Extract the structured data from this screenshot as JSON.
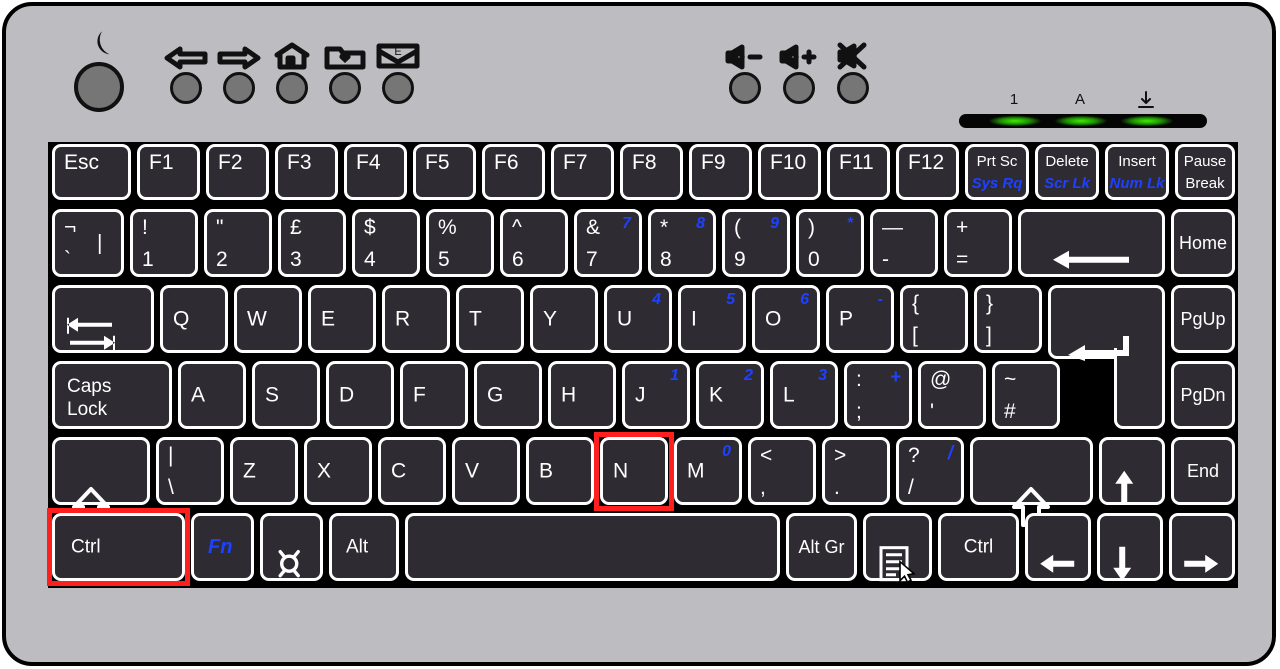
{
  "device": {
    "name": "laptop-style-uk-keyboard",
    "body_color": "#bdbdc1",
    "key_color": "#2e2b33",
    "key_border_color": "#ffffff",
    "legend_color": "#ffffff",
    "fn_legend_color": "#1e41ff",
    "highlight_color": "#ff1f1f",
    "led_color": "#3cf000"
  },
  "hotkeys": [
    {
      "name": "sleep-button",
      "glyph": "moon"
    },
    {
      "name": "back-button",
      "glyph": "arrow-left"
    },
    {
      "name": "forward-button",
      "glyph": "arrow-right"
    },
    {
      "name": "home-button",
      "glyph": "house"
    },
    {
      "name": "favorites-button",
      "glyph": "folder-heart"
    },
    {
      "name": "email-button",
      "glyph": "envelope-e"
    },
    {
      "name": "volume-down-button",
      "glyph": "speaker-minus"
    },
    {
      "name": "volume-up-button",
      "glyph": "speaker-plus"
    },
    {
      "name": "mute-button",
      "glyph": "speaker-mute"
    }
  ],
  "leds": [
    {
      "name": "num-lock-led",
      "label": "1"
    },
    {
      "name": "caps-lock-led",
      "label": "A"
    },
    {
      "name": "scroll-lock-led",
      "label": "scroll-lock-glyph"
    }
  ],
  "highlighted_keys": [
    "N",
    "Ctrl"
  ],
  "rows": {
    "function_row": [
      {
        "name": "esc",
        "main": "Esc"
      },
      {
        "name": "f1",
        "main": "F1"
      },
      {
        "name": "f2",
        "main": "F2"
      },
      {
        "name": "f3",
        "main": "F3"
      },
      {
        "name": "f4",
        "main": "F4"
      },
      {
        "name": "f5",
        "main": "F5"
      },
      {
        "name": "f6",
        "main": "F6"
      },
      {
        "name": "f7",
        "main": "F7"
      },
      {
        "name": "f8",
        "main": "F8"
      },
      {
        "name": "f9",
        "main": "F9"
      },
      {
        "name": "f10",
        "main": "F10"
      },
      {
        "name": "f11",
        "main": "F11"
      },
      {
        "name": "f12",
        "main": "F12"
      },
      {
        "name": "print-screen",
        "main": "Prt Sc",
        "alt": "Sys Rq"
      },
      {
        "name": "delete",
        "main": "Delete",
        "alt": "Scr Lk"
      },
      {
        "name": "insert",
        "main": "Insert",
        "alt": "Num Lk"
      },
      {
        "name": "pause-break",
        "main": "Pause",
        "main2": "Break"
      }
    ],
    "number_row": [
      {
        "name": "backtick",
        "top": "¬",
        "bottom": "`",
        "mid": "|"
      },
      {
        "name": "digit-1",
        "top": "!",
        "bottom": "1"
      },
      {
        "name": "digit-2",
        "top": "\"",
        "bottom": "2"
      },
      {
        "name": "digit-3",
        "top": "£",
        "bottom": "3"
      },
      {
        "name": "digit-4",
        "top": "$",
        "bottom": "4"
      },
      {
        "name": "digit-5",
        "top": "%",
        "bottom": "5"
      },
      {
        "name": "digit-6",
        "top": "^",
        "bottom": "6"
      },
      {
        "name": "digit-7",
        "top": "&",
        "bottom": "7",
        "alt": "7"
      },
      {
        "name": "digit-8",
        "top": "*",
        "bottom": "8",
        "alt": "8"
      },
      {
        "name": "digit-9",
        "top": "(",
        "bottom": "9",
        "alt": "9"
      },
      {
        "name": "digit-0",
        "top": ")",
        "bottom": "0",
        "alt": "*"
      },
      {
        "name": "minus",
        "top": "—",
        "bottom": "-"
      },
      {
        "name": "equals",
        "top": "+",
        "bottom": "="
      },
      {
        "name": "backspace",
        "glyph": "arrow-left-long"
      },
      {
        "name": "home",
        "main": "Home"
      }
    ],
    "top_letter_row": [
      {
        "name": "tab",
        "glyph": "tab-arrows"
      },
      {
        "name": "q",
        "main": "Q"
      },
      {
        "name": "w",
        "main": "W"
      },
      {
        "name": "e",
        "main": "E"
      },
      {
        "name": "r",
        "main": "R"
      },
      {
        "name": "t",
        "main": "T"
      },
      {
        "name": "y",
        "main": "Y"
      },
      {
        "name": "u",
        "main": "U",
        "alt": "4"
      },
      {
        "name": "i",
        "main": "I",
        "alt": "5"
      },
      {
        "name": "o",
        "main": "O",
        "alt": "6"
      },
      {
        "name": "p",
        "main": "P",
        "alt": "-"
      },
      {
        "name": "bracket-left",
        "top": "{",
        "bottom": "["
      },
      {
        "name": "bracket-right",
        "top": "}",
        "bottom": "]"
      },
      {
        "name": "enter",
        "glyph": "enter-arrow"
      },
      {
        "name": "page-up",
        "main": "PgUp"
      }
    ],
    "home_row": [
      {
        "name": "caps-lock",
        "main": "Caps",
        "main2": "Lock"
      },
      {
        "name": "a",
        "main": "A"
      },
      {
        "name": "s",
        "main": "S"
      },
      {
        "name": "d",
        "main": "D"
      },
      {
        "name": "f",
        "main": "F"
      },
      {
        "name": "g",
        "main": "G"
      },
      {
        "name": "h",
        "main": "H"
      },
      {
        "name": "j",
        "main": "J",
        "alt": "1"
      },
      {
        "name": "k",
        "main": "K",
        "alt": "2"
      },
      {
        "name": "l",
        "main": "L",
        "alt": "3"
      },
      {
        "name": "semicolon",
        "top": ":",
        "bottom": ";",
        "alt": "+"
      },
      {
        "name": "apostrophe",
        "top": "@",
        "bottom": "'"
      },
      {
        "name": "hash",
        "top": "~",
        "bottom": "#"
      },
      {
        "name": "page-down",
        "main": "PgDn"
      }
    ],
    "bottom_letter_row": [
      {
        "name": "shift-left",
        "glyph": "shift-arrow"
      },
      {
        "name": "backslash",
        "top": "|",
        "bottom": "\\"
      },
      {
        "name": "z",
        "main": "Z"
      },
      {
        "name": "x",
        "main": "X"
      },
      {
        "name": "c",
        "main": "C"
      },
      {
        "name": "v",
        "main": "V"
      },
      {
        "name": "b",
        "main": "B"
      },
      {
        "name": "n",
        "main": "N",
        "highlight": true
      },
      {
        "name": "m",
        "main": "M",
        "alt": "0"
      },
      {
        "name": "comma",
        "top": "<",
        "bottom": ","
      },
      {
        "name": "period",
        "top": ">",
        "bottom": "."
      },
      {
        "name": "slash",
        "top": "?",
        "bottom": "/",
        "alt": "/"
      },
      {
        "name": "shift-right",
        "glyph": "shift-arrow"
      },
      {
        "name": "arrow-up",
        "glyph": "arrow-up"
      },
      {
        "name": "end",
        "main": "End"
      }
    ],
    "modifier_row": [
      {
        "name": "ctrl-left",
        "main": "Ctrl",
        "highlight": true
      },
      {
        "name": "fn",
        "main": "Fn",
        "fn": true
      },
      {
        "name": "super",
        "glyph": "super-glyph"
      },
      {
        "name": "alt",
        "main": "Alt"
      },
      {
        "name": "space",
        "main": ""
      },
      {
        "name": "alt-gr",
        "main": "Alt Gr"
      },
      {
        "name": "menu",
        "glyph": "menu-glyph"
      },
      {
        "name": "ctrl-right",
        "main": "Ctrl"
      },
      {
        "name": "arrow-left",
        "glyph": "arrow-left"
      },
      {
        "name": "arrow-down",
        "glyph": "arrow-down"
      },
      {
        "name": "arrow-right",
        "glyph": "arrow-right"
      }
    ]
  }
}
